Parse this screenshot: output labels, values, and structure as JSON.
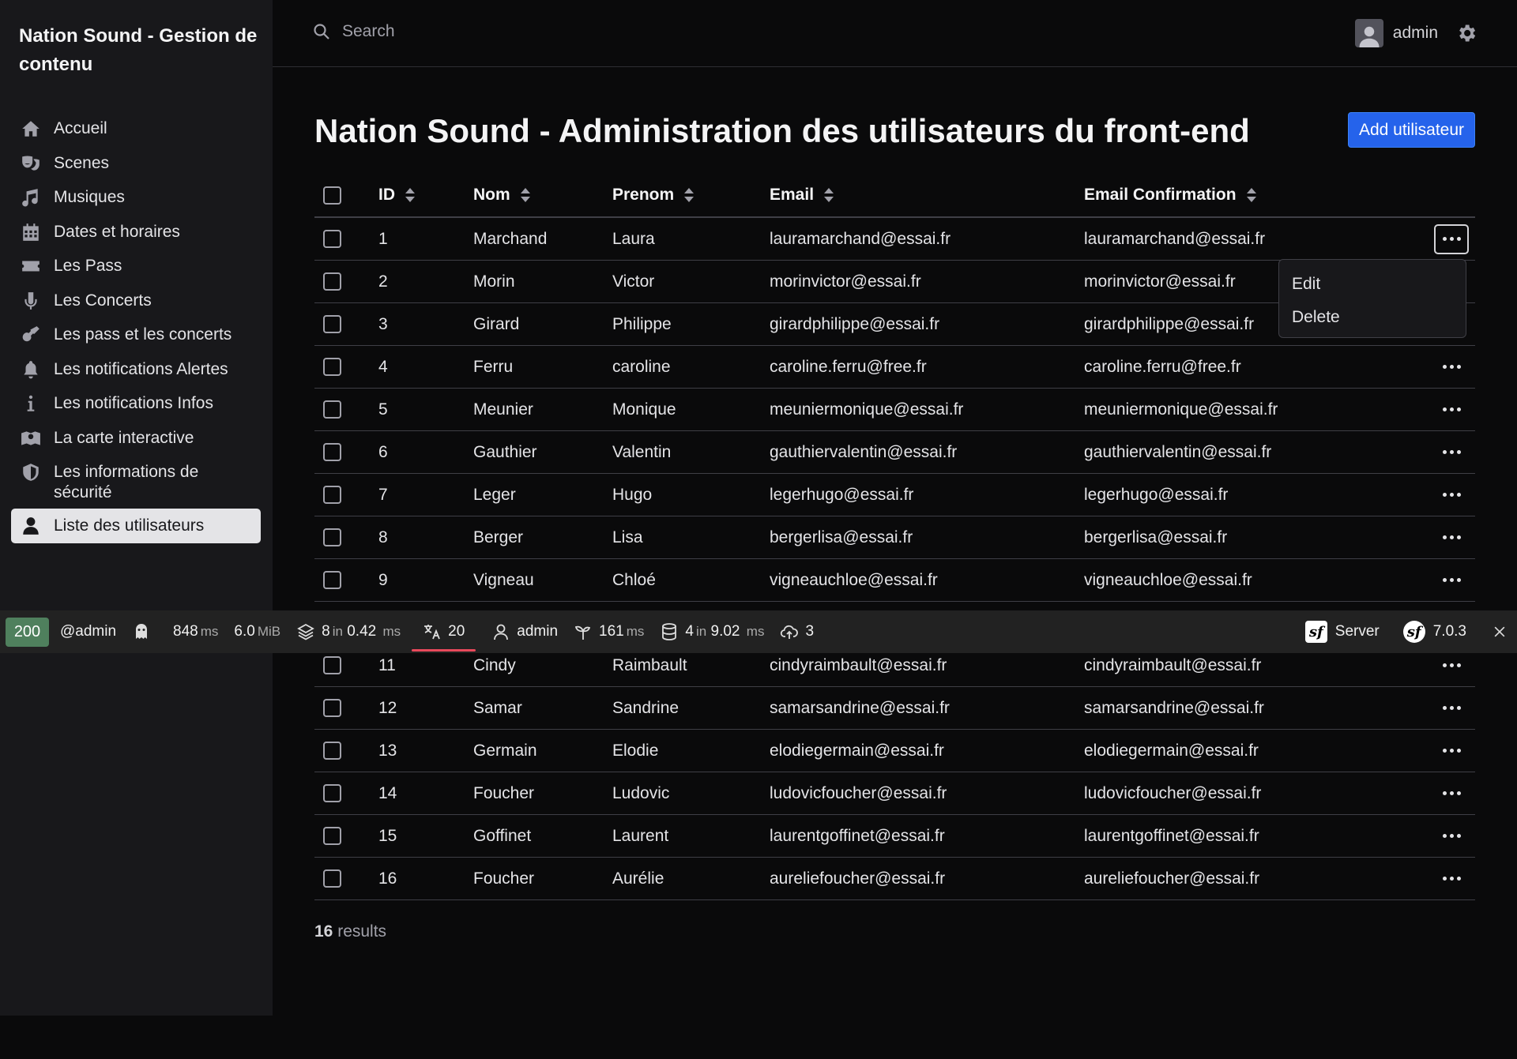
{
  "sidebar": {
    "brand": "Nation Sound - Gestion de contenu",
    "items": [
      {
        "label": "Accueil",
        "icon": "home-icon"
      },
      {
        "label": "Scenes",
        "icon": "theater-masks-icon"
      },
      {
        "label": "Musiques",
        "icon": "music-icon"
      },
      {
        "label": "Dates et horaires",
        "icon": "calendar-icon"
      },
      {
        "label": "Les Pass",
        "icon": "ticket-icon"
      },
      {
        "label": "Les Concerts",
        "icon": "microphone-icon"
      },
      {
        "label": "Les pass et les concerts",
        "icon": "guitar-icon"
      },
      {
        "label": "Les notifications Alertes",
        "icon": "bell-icon"
      },
      {
        "label": "Les notifications Infos",
        "icon": "info-icon"
      },
      {
        "label": "La carte interactive",
        "icon": "map-icon"
      },
      {
        "label": "Les informations de sécurité",
        "icon": "shield-icon"
      },
      {
        "label": "Liste des utilisateurs",
        "icon": "user-icon",
        "active": true
      }
    ]
  },
  "topbar": {
    "search_placeholder": "Search",
    "username": "admin"
  },
  "page": {
    "title": "Nation Sound - Administration des utilisateurs du front-end",
    "add_button": "Add utilisateur",
    "results_count": "16",
    "results_label": "results"
  },
  "table": {
    "columns": [
      "ID",
      "Nom",
      "Prenom",
      "Email",
      "Email Confirmation"
    ],
    "rows_top": [
      {
        "id": "1",
        "nom": "Marchand",
        "prenom": "Laura",
        "email": "lauramarchand@essai.fr",
        "email_conf": "lauramarchand@essai.fr"
      },
      {
        "id": "2",
        "nom": "Morin",
        "prenom": "Victor",
        "email": "morinvictor@essai.fr",
        "email_conf": "morinvictor@essai.fr"
      },
      {
        "id": "3",
        "nom": "Girard",
        "prenom": "Philippe",
        "email": "girardphilippe@essai.fr",
        "email_conf": "girardphilippe@essai.fr"
      },
      {
        "id": "4",
        "nom": "Ferru",
        "prenom": "caroline",
        "email": "caroline.ferru@free.fr",
        "email_conf": "caroline.ferru@free.fr"
      },
      {
        "id": "5",
        "nom": "Meunier",
        "prenom": "Monique",
        "email": "meuniermonique@essai.fr",
        "email_conf": "meuniermonique@essai.fr"
      },
      {
        "id": "6",
        "nom": "Gauthier",
        "prenom": "Valentin",
        "email": "gauthiervalentin@essai.fr",
        "email_conf": "gauthiervalentin@essai.fr"
      },
      {
        "id": "7",
        "nom": "Leger",
        "prenom": "Hugo",
        "email": "legerhugo@essai.fr",
        "email_conf": "legerhugo@essai.fr"
      },
      {
        "id": "8",
        "nom": "Berger",
        "prenom": "Lisa",
        "email": "bergerlisa@essai.fr",
        "email_conf": "bergerlisa@essai.fr"
      },
      {
        "id": "9",
        "nom": "Vigneau",
        "prenom": "Chloé",
        "email": "vigneauchloe@essai.fr",
        "email_conf": "vigneauchloe@essai.fr"
      }
    ],
    "rows_bottom": [
      {
        "id": "11",
        "nom": "Cindy",
        "prenom": "Raimbault",
        "email": "cindyraimbault@essai.fr",
        "email_conf": "cindyraimbault@essai.fr"
      },
      {
        "id": "12",
        "nom": "Samar",
        "prenom": "Sandrine",
        "email": "samarsandrine@essai.fr",
        "email_conf": "samarsandrine@essai.fr"
      },
      {
        "id": "13",
        "nom": "Germain",
        "prenom": "Elodie",
        "email": "elodiegermain@essai.fr",
        "email_conf": "elodiegermain@essai.fr"
      },
      {
        "id": "14",
        "nom": "Foucher",
        "prenom": "Ludovic",
        "email": "ludovicfoucher@essai.fr",
        "email_conf": "ludovicfoucher@essai.fr"
      },
      {
        "id": "15",
        "nom": "Goffinet",
        "prenom": "Laurent",
        "email": "laurentgoffinet@essai.fr",
        "email_conf": "laurentgoffinet@essai.fr"
      },
      {
        "id": "16",
        "nom": "Foucher",
        "prenom": "Aurélie",
        "email": "aureliefoucher@essai.fr",
        "email_conf": "aureliefoucher@essai.fr"
      }
    ]
  },
  "row_menu": {
    "edit": "Edit",
    "delete": "Delete"
  },
  "debug_toolbar": {
    "status": "200",
    "route": "@admin",
    "time_value": "848",
    "time_unit": "ms",
    "memory": "6.0",
    "memory_unit": "MiB",
    "forms_count": "8",
    "forms_in": "in",
    "forms_time": "0.42",
    "forms_unit": "ms",
    "translations": "20",
    "user": "admin",
    "twig_time": "161",
    "twig_unit": "ms",
    "db_queries": "4",
    "db_in": "in",
    "db_time": "9.02",
    "db_unit": "ms",
    "assets": "3",
    "server_label": "Server",
    "symfony_version": "7.0.3"
  },
  "colors": {
    "accent": "#2563eb",
    "status_ok": "#4f805d",
    "translation_underline": "#e8495b"
  }
}
